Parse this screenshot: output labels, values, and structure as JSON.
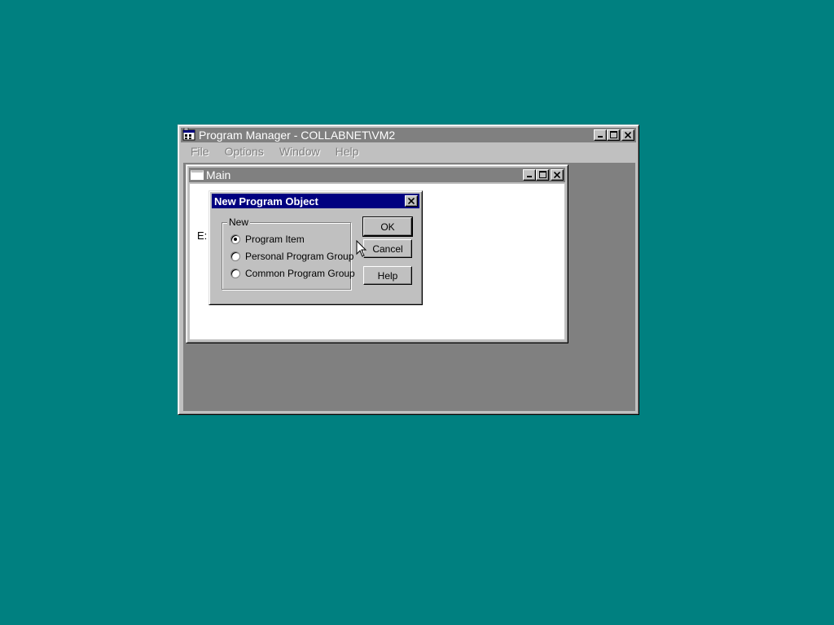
{
  "progman": {
    "title": "Program Manager - COLLABNET\\VM2",
    "menu": [
      "File",
      "Options",
      "Window",
      "Help"
    ]
  },
  "main_window": {
    "title": "Main",
    "partial_label": "E:"
  },
  "dialog": {
    "title": "New Program Object",
    "group_label": "New",
    "options": [
      {
        "label": "Program Item",
        "selected": true
      },
      {
        "label": "Personal Program Group",
        "selected": false
      },
      {
        "label": "Common Program Group",
        "selected": false
      }
    ],
    "buttons": {
      "ok": "OK",
      "cancel": "Cancel",
      "help": "Help"
    }
  },
  "colors": {
    "desktop": "#008080",
    "active_title": "#000080",
    "inactive_title": "#808080",
    "face": "#c0c0c0"
  },
  "icons": [
    "progman-icon",
    "main-window-icon",
    "minimize-icon",
    "maximize-icon",
    "close-icon",
    "mouse-cursor-icon"
  ]
}
